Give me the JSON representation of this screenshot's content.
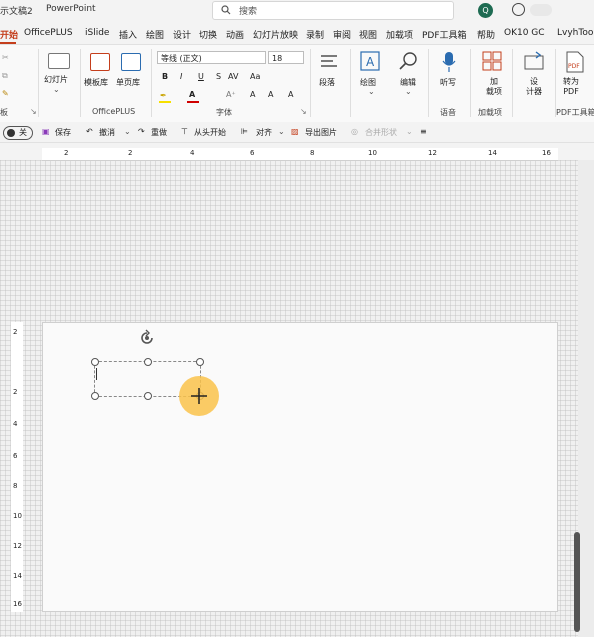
{
  "titlebar": {
    "doc_title": "示文稿2",
    "app_name": "PowerPoint",
    "search_placeholder": "搜索",
    "avatar_letter": "Q"
  },
  "tabs": [
    "开始",
    "OfficePLUS",
    "iSlide",
    "插入",
    "绘图",
    "设计",
    "切换",
    "动画",
    "幻灯片放映",
    "录制",
    "审阅",
    "视图",
    "加载项",
    "PDF工具箱",
    "帮助",
    "OK10 GC",
    "LvyhToo"
  ],
  "ribbon": {
    "clipboard_group": "板",
    "new_slide": "幻灯片",
    "template_lib": "模板库",
    "single_page_lib": "单页库",
    "officeplus_group": "OfficePLUS",
    "font_name": "等线 (正文)",
    "font_size": "18",
    "font_group": "字体",
    "bold": "B",
    "italic": "I",
    "underline": "U",
    "strike": "S",
    "spacing": "AV",
    "grow": "A",
    "shrink": "A",
    "clear": "A",
    "paragraph": "段落",
    "drawing": "绘图",
    "editing": "编辑",
    "dictate": "听写",
    "voice_group": "语音",
    "addins": "加\n载项",
    "addins_group": "加载项",
    "designer": "设\n计器",
    "convert_pdf": "转为\nPDF",
    "pdf_group": "PDF工具箱"
  },
  "qat": {
    "toggle_label": "关",
    "save": "保存",
    "undo": "撤消",
    "redo": "重做",
    "from_start": "从头开始",
    "align": "对齐",
    "export_image": "导出图片",
    "merge_shapes": "合并形状"
  },
  "ruler": {
    "h_ticks": [
      "2",
      "2",
      "4",
      "6",
      "8",
      "10",
      "12",
      "14",
      "16"
    ],
    "v_ticks": [
      "2",
      "2",
      "4",
      "6",
      "8",
      "10",
      "12",
      "14",
      "16"
    ]
  },
  "colors": {
    "accent": "#c43e1c",
    "cursor_highlight": "#f9c24a",
    "avatar": "#1e6b52"
  }
}
